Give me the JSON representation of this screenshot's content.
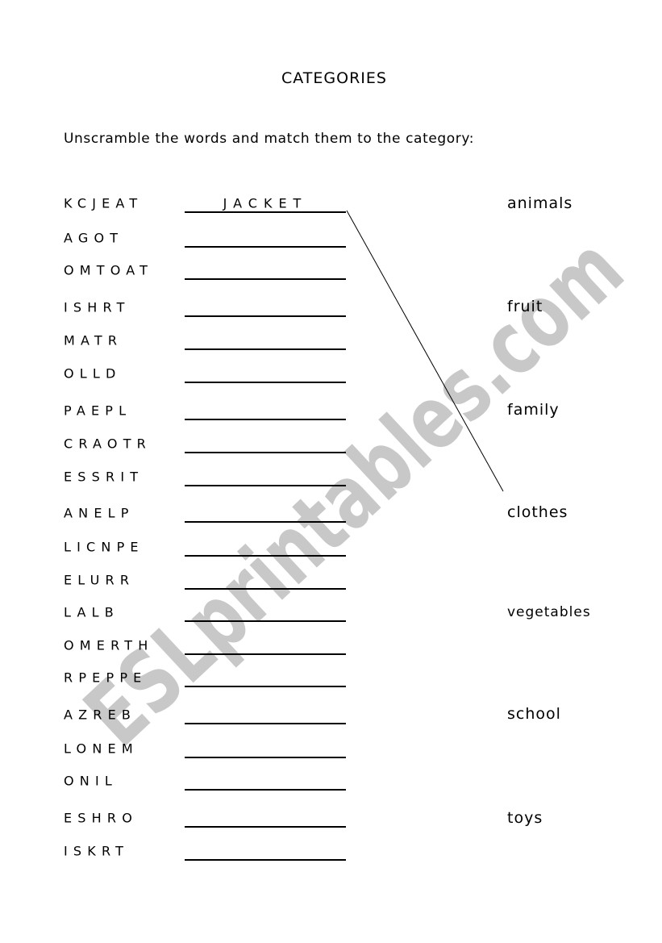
{
  "title": "CATEGORIES",
  "instruction": "Unscramble the words and match them to the category:",
  "rows": [
    {
      "scrambled": "KCJEAT",
      "answer": "JACKET"
    },
    {
      "scrambled": "AGOT",
      "answer": ""
    },
    {
      "scrambled": "OMTOAT",
      "answer": ""
    },
    {
      "scrambled": "ISHRT",
      "answer": ""
    },
    {
      "scrambled": "MATR",
      "answer": ""
    },
    {
      "scrambled": "OLLD",
      "answer": ""
    },
    {
      "scrambled": "PAEPL",
      "answer": ""
    },
    {
      "scrambled": "CRAOTR",
      "answer": ""
    },
    {
      "scrambled": "ESSRIT",
      "answer": ""
    },
    {
      "scrambled": "ANELP",
      "answer": ""
    },
    {
      "scrambled": "LICNPE",
      "answer": ""
    },
    {
      "scrambled": "ELURR",
      "answer": ""
    },
    {
      "scrambled": "LALB",
      "answer": ""
    },
    {
      "scrambled": "OMERTH",
      "answer": ""
    },
    {
      "scrambled": "RPEPPE",
      "answer": ""
    },
    {
      "scrambled": "AZREB",
      "answer": ""
    },
    {
      "scrambled": "LONEM",
      "answer": ""
    },
    {
      "scrambled": "ONIL",
      "answer": ""
    },
    {
      "scrambled": "ESHRO",
      "answer": ""
    },
    {
      "scrambled": "ISKRT",
      "answer": ""
    }
  ],
  "categories": [
    "animals",
    "fruit",
    "family",
    "clothes",
    "vegetables",
    "school",
    "toys"
  ],
  "match": {
    "from_row": 0,
    "to_category": 3
  },
  "watermark": "ESLprintables.com",
  "colors": {
    "text": "#000000",
    "watermark": "#c8c8c8"
  }
}
